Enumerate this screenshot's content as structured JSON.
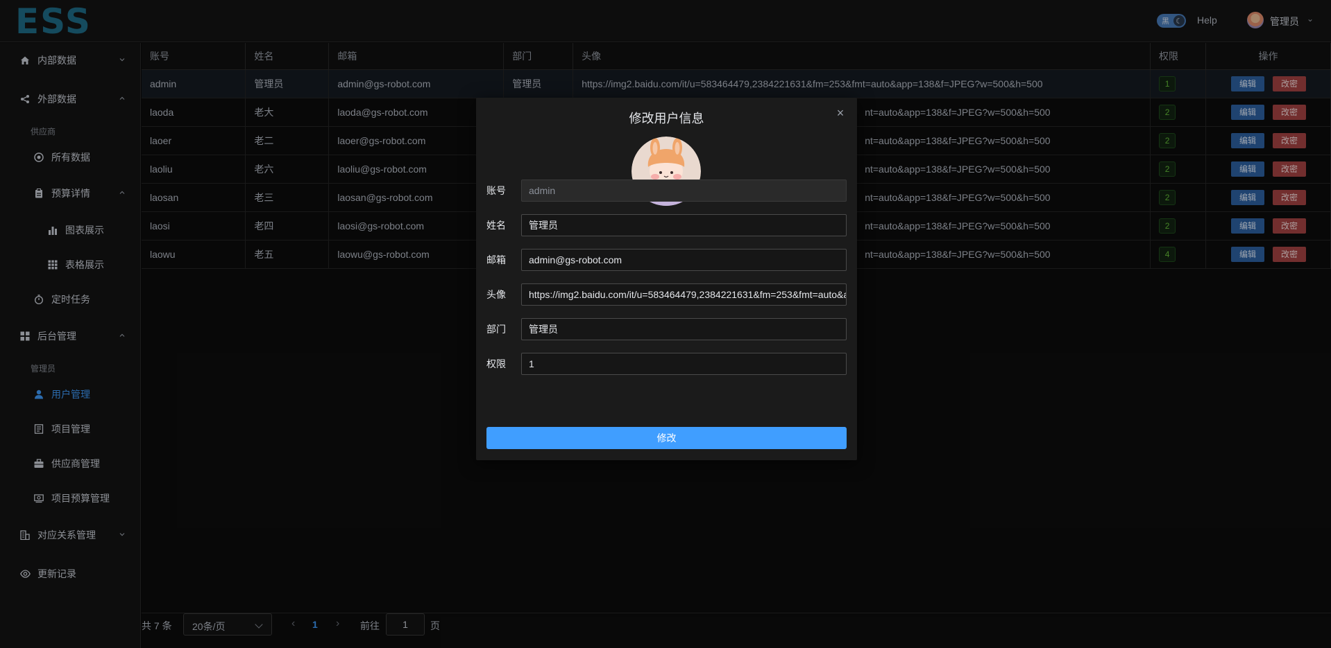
{
  "header": {
    "logo_text": "ESS",
    "theme_label": "黑",
    "help_label": "Help",
    "user_name": "管理员"
  },
  "sidebar": {
    "items": [
      {
        "label": "内部数据",
        "icon": "home-icon"
      },
      {
        "label": "外部数据",
        "icon": "share-icon"
      },
      {
        "label": "供应商"
      },
      {
        "label": "所有数据",
        "icon": "target-icon"
      },
      {
        "label": "预算详情",
        "icon": "clipboard-icon"
      },
      {
        "label": "图表展示",
        "icon": "bar-chart-icon"
      },
      {
        "label": "表格展示",
        "icon": "grid-icon"
      },
      {
        "label": "定时任务",
        "icon": "stopwatch-icon"
      },
      {
        "label": "后台管理",
        "icon": "menu-grid-icon"
      },
      {
        "label": "管理员"
      },
      {
        "label": "用户管理",
        "icon": "user-icon"
      },
      {
        "label": "项目管理",
        "icon": "document-icon"
      },
      {
        "label": "供应商管理",
        "icon": "briefcase-icon"
      },
      {
        "label": "项目预算管理",
        "icon": "money-icon"
      },
      {
        "label": "对应关系管理",
        "icon": "office-building-icon"
      },
      {
        "label": "更新记录",
        "icon": "eye-icon"
      }
    ]
  },
  "table": {
    "columns": [
      "账号",
      "姓名",
      "邮箱",
      "部门",
      "头像",
      "权限",
      "操作"
    ],
    "edit_label": "编辑",
    "reset_label": "改密",
    "rows": [
      {
        "account": "admin",
        "name": "管理员",
        "email": "admin@gs-robot.com",
        "dept": "管理员",
        "avatar": "https://img2.baidu.com/it/u=583464479,2384221631&fm=253&fmt=auto&app=138&f=JPEG?w=500&h=500",
        "perm": "1"
      },
      {
        "account": "laoda",
        "name": "老大",
        "email": "laoda@gs-robot.com",
        "dept": "",
        "avatar": "nt=auto&app=138&f=JPEG?w=500&h=500",
        "perm": "2"
      },
      {
        "account": "laoer",
        "name": "老二",
        "email": "laoer@gs-robot.com",
        "dept": "",
        "avatar": "nt=auto&app=138&f=JPEG?w=500&h=500",
        "perm": "2"
      },
      {
        "account": "laoliu",
        "name": "老六",
        "email": "laoliu@gs-robot.com",
        "dept": "",
        "avatar": "nt=auto&app=138&f=JPEG?w=500&h=500",
        "perm": "2"
      },
      {
        "account": "laosan",
        "name": "老三",
        "email": "laosan@gs-robot.com",
        "dept": "",
        "avatar": "nt=auto&app=138&f=JPEG?w=500&h=500",
        "perm": "2"
      },
      {
        "account": "laosi",
        "name": "老四",
        "email": "laosi@gs-robot.com",
        "dept": "",
        "avatar": "nt=auto&app=138&f=JPEG?w=500&h=500",
        "perm": "2"
      },
      {
        "account": "laowu",
        "name": "老五",
        "email": "laowu@gs-robot.com",
        "dept": "",
        "avatar": "nt=auto&app=138&f=JPEG?w=500&h=500",
        "perm": "4"
      }
    ]
  },
  "pager": {
    "total": "共 7 条",
    "page_size": "20条/页",
    "current_page": "1",
    "goto_label": "前往",
    "goto_value": "1",
    "page_word": "页"
  },
  "modal": {
    "title": "修改用户信息",
    "fields": [
      {
        "label": "账号",
        "value": "admin"
      },
      {
        "label": "姓名",
        "value": "管理员"
      },
      {
        "label": "邮箱",
        "value": "admin@gs-robot.com"
      },
      {
        "label": "头像",
        "value": "https://img2.baidu.com/it/u=583464479,2384221631&fm=253&fmt=auto&app=138&f=JPEG?w=500&h=500"
      },
      {
        "label": "部门",
        "value": "管理员"
      },
      {
        "label": "权限",
        "value": "1"
      }
    ],
    "submit_label": "修改"
  },
  "colors": {
    "accent": "#409eff",
    "edit_button": "#2f64a6",
    "reset_button": "#a94444",
    "perm_tag_text": "#67c23a",
    "logo": "#1f6f8b"
  }
}
